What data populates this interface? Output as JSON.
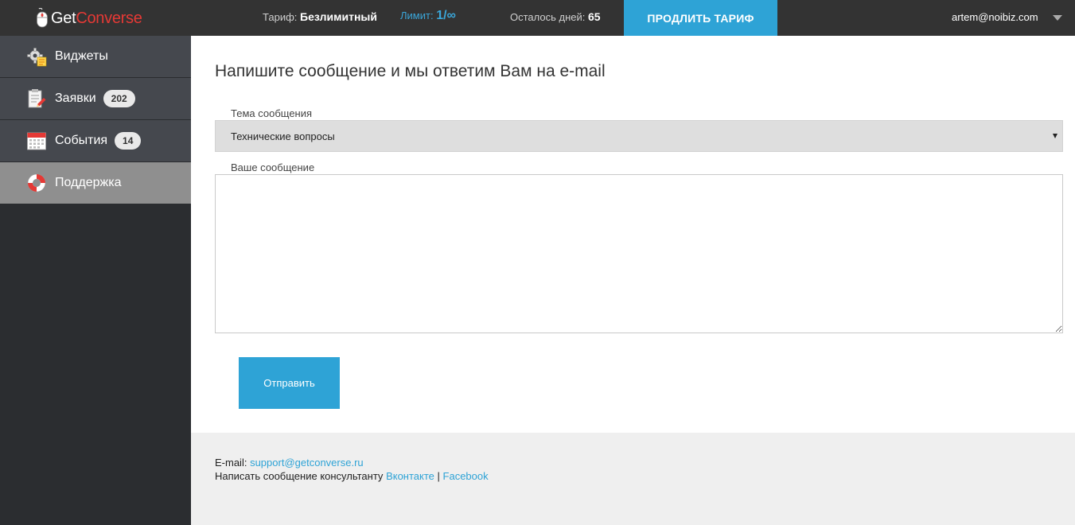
{
  "header": {
    "logo_get": "Get",
    "logo_converse": "Converse",
    "tariff_label": "Тариф:",
    "tariff_value": "Безлимитный",
    "limit_label": "Лимит:",
    "limit_value": "1/∞",
    "days_label": "Осталось дней:",
    "days_value": "65",
    "extend_label": "ПРОДЛИТЬ ТАРИФ",
    "user_email": "artem@noibiz.com"
  },
  "sidebar": {
    "items": [
      {
        "label": "Виджеты",
        "icon": "widgets-gear-icon",
        "badge": ""
      },
      {
        "label": "Заявки",
        "icon": "clipboard-icon",
        "badge": "202"
      },
      {
        "label": "События",
        "icon": "calendar-icon",
        "badge": "14"
      },
      {
        "label": "Поддержка",
        "icon": "lifebuoy-icon",
        "badge": "",
        "active": true
      }
    ]
  },
  "main": {
    "title": "Напишите сообщение и мы ответим Вам на e-mail",
    "subject_label": "Тема сообщения",
    "subject_value": "Технические вопросы",
    "message_label": "Ваше сообщение",
    "message_value": "",
    "send_label": "Отправить"
  },
  "footer": {
    "email_label": "E-mail:",
    "email_link": "support@getconverse.ru",
    "consultant_text": "Написать сообщение консультанту",
    "vk_link": "Вконтакте",
    "separator": "|",
    "fb_link": "Facebook"
  },
  "colors": {
    "topbar": "#333333",
    "accent": "#2ea3d6",
    "brand_red": "#e53935",
    "sidebar_item": "#45484e",
    "sidebar_active": "#8f8f8f",
    "sidebar_bg": "#2b2d30",
    "footer_bg": "#efefef"
  }
}
